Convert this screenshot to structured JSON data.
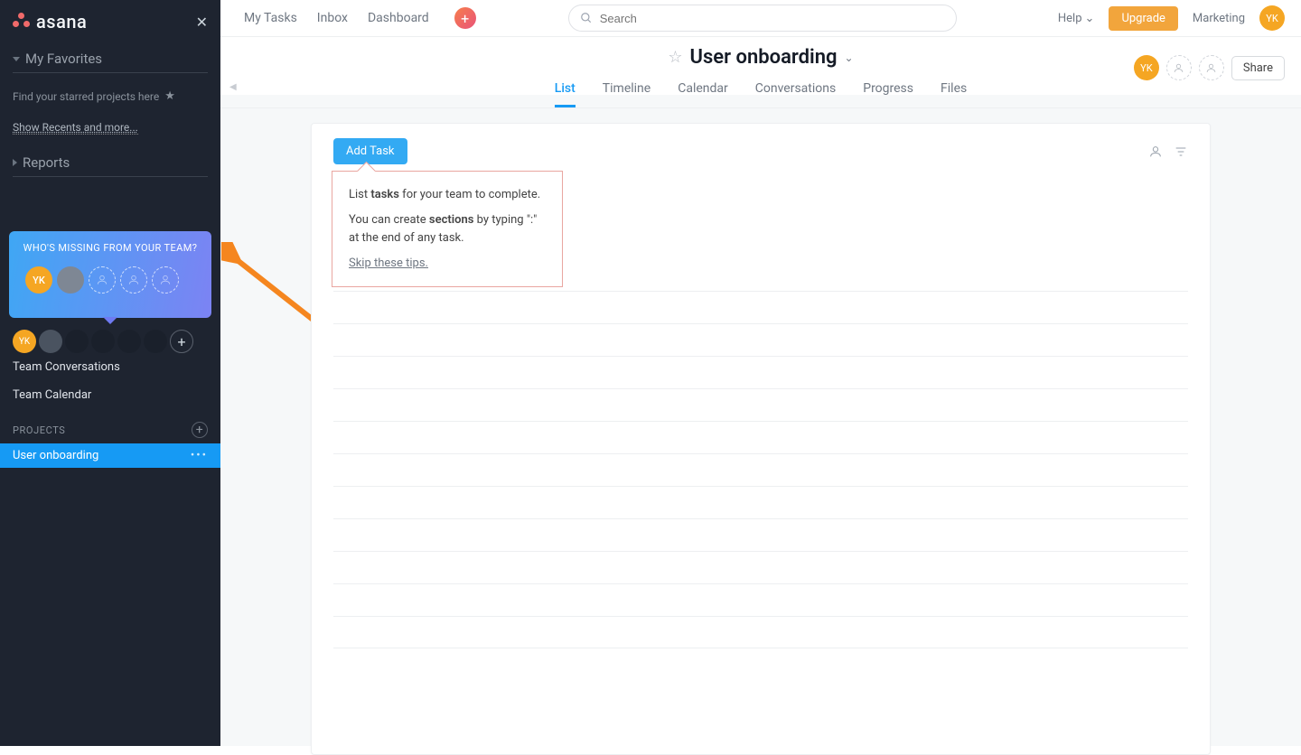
{
  "brand": "asana",
  "sidebar": {
    "favorites_label": "My Favorites",
    "favorites_hint": "Find your starred projects here",
    "recents_link": "Show Recents and more...",
    "reports_label": "Reports",
    "team_card_title": "WHO'S MISSING FROM YOUR TEAM?",
    "avatar_initials": "YK",
    "links": {
      "conversations": "Team Conversations",
      "calendar": "Team Calendar"
    },
    "projects_label": "PROJECTS",
    "project_item": "User onboarding"
  },
  "topnav": {
    "my_tasks": "My Tasks",
    "inbox": "Inbox",
    "dashboard": "Dashboard",
    "search_placeholder": "Search",
    "help": "Help",
    "upgrade": "Upgrade",
    "marketing": "Marketing",
    "avatar_initials": "YK"
  },
  "project": {
    "title": "User onboarding",
    "tabs": [
      "List",
      "Timeline",
      "Calendar",
      "Conversations",
      "Progress",
      "Files"
    ],
    "active_tab": 0,
    "share": "Share",
    "avatar_initials": "YK",
    "add_task": "Add Task"
  },
  "tip": {
    "line1a": "List ",
    "line1b": "tasks",
    "line1c": " for your team to complete.",
    "line2a": "You can create ",
    "line2b": "sections",
    "line2c": " by typing \":\" at the end of any task.",
    "skip": "Skip these tips."
  }
}
